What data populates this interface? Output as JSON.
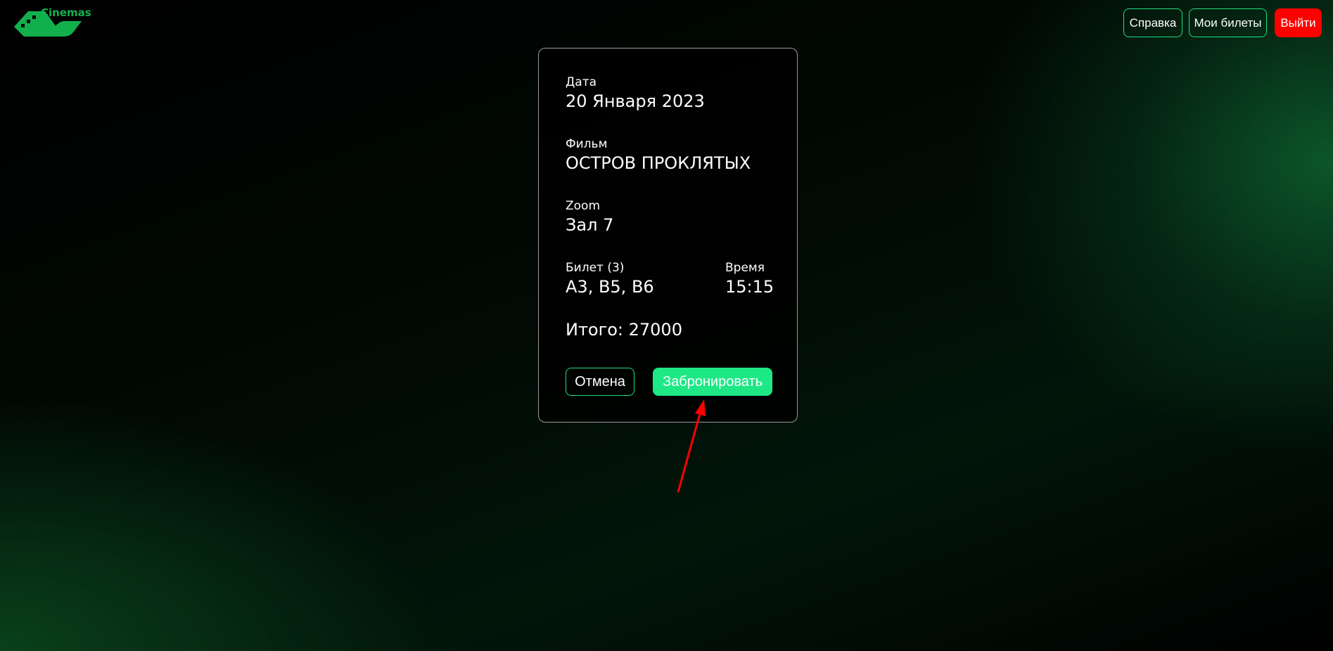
{
  "header": {
    "logo_text": "Cinemas",
    "buttons": {
      "help": "Справка",
      "my_tickets": "Мои билеты",
      "logout": "Выйти"
    }
  },
  "booking": {
    "date_label": "Дата",
    "date_value": "20 Января 2023",
    "film_label": "Фильм",
    "film_value": "ОСТРОВ ПРОКЛЯТЫХ",
    "hall_label": "Zoom",
    "hall_value": "Зал 7",
    "tickets_label": "Билет (3)",
    "tickets_value": "A3, B5, B6",
    "time_label": "Время",
    "time_value": "15:15",
    "total": "Итого: 27000",
    "cancel_label": "Отмена",
    "book_label": "Забронировать"
  },
  "colors": {
    "accent": "#1ee886",
    "logout": "#ff0000",
    "logo": "#12b04c",
    "arrow": "#ff0000"
  }
}
